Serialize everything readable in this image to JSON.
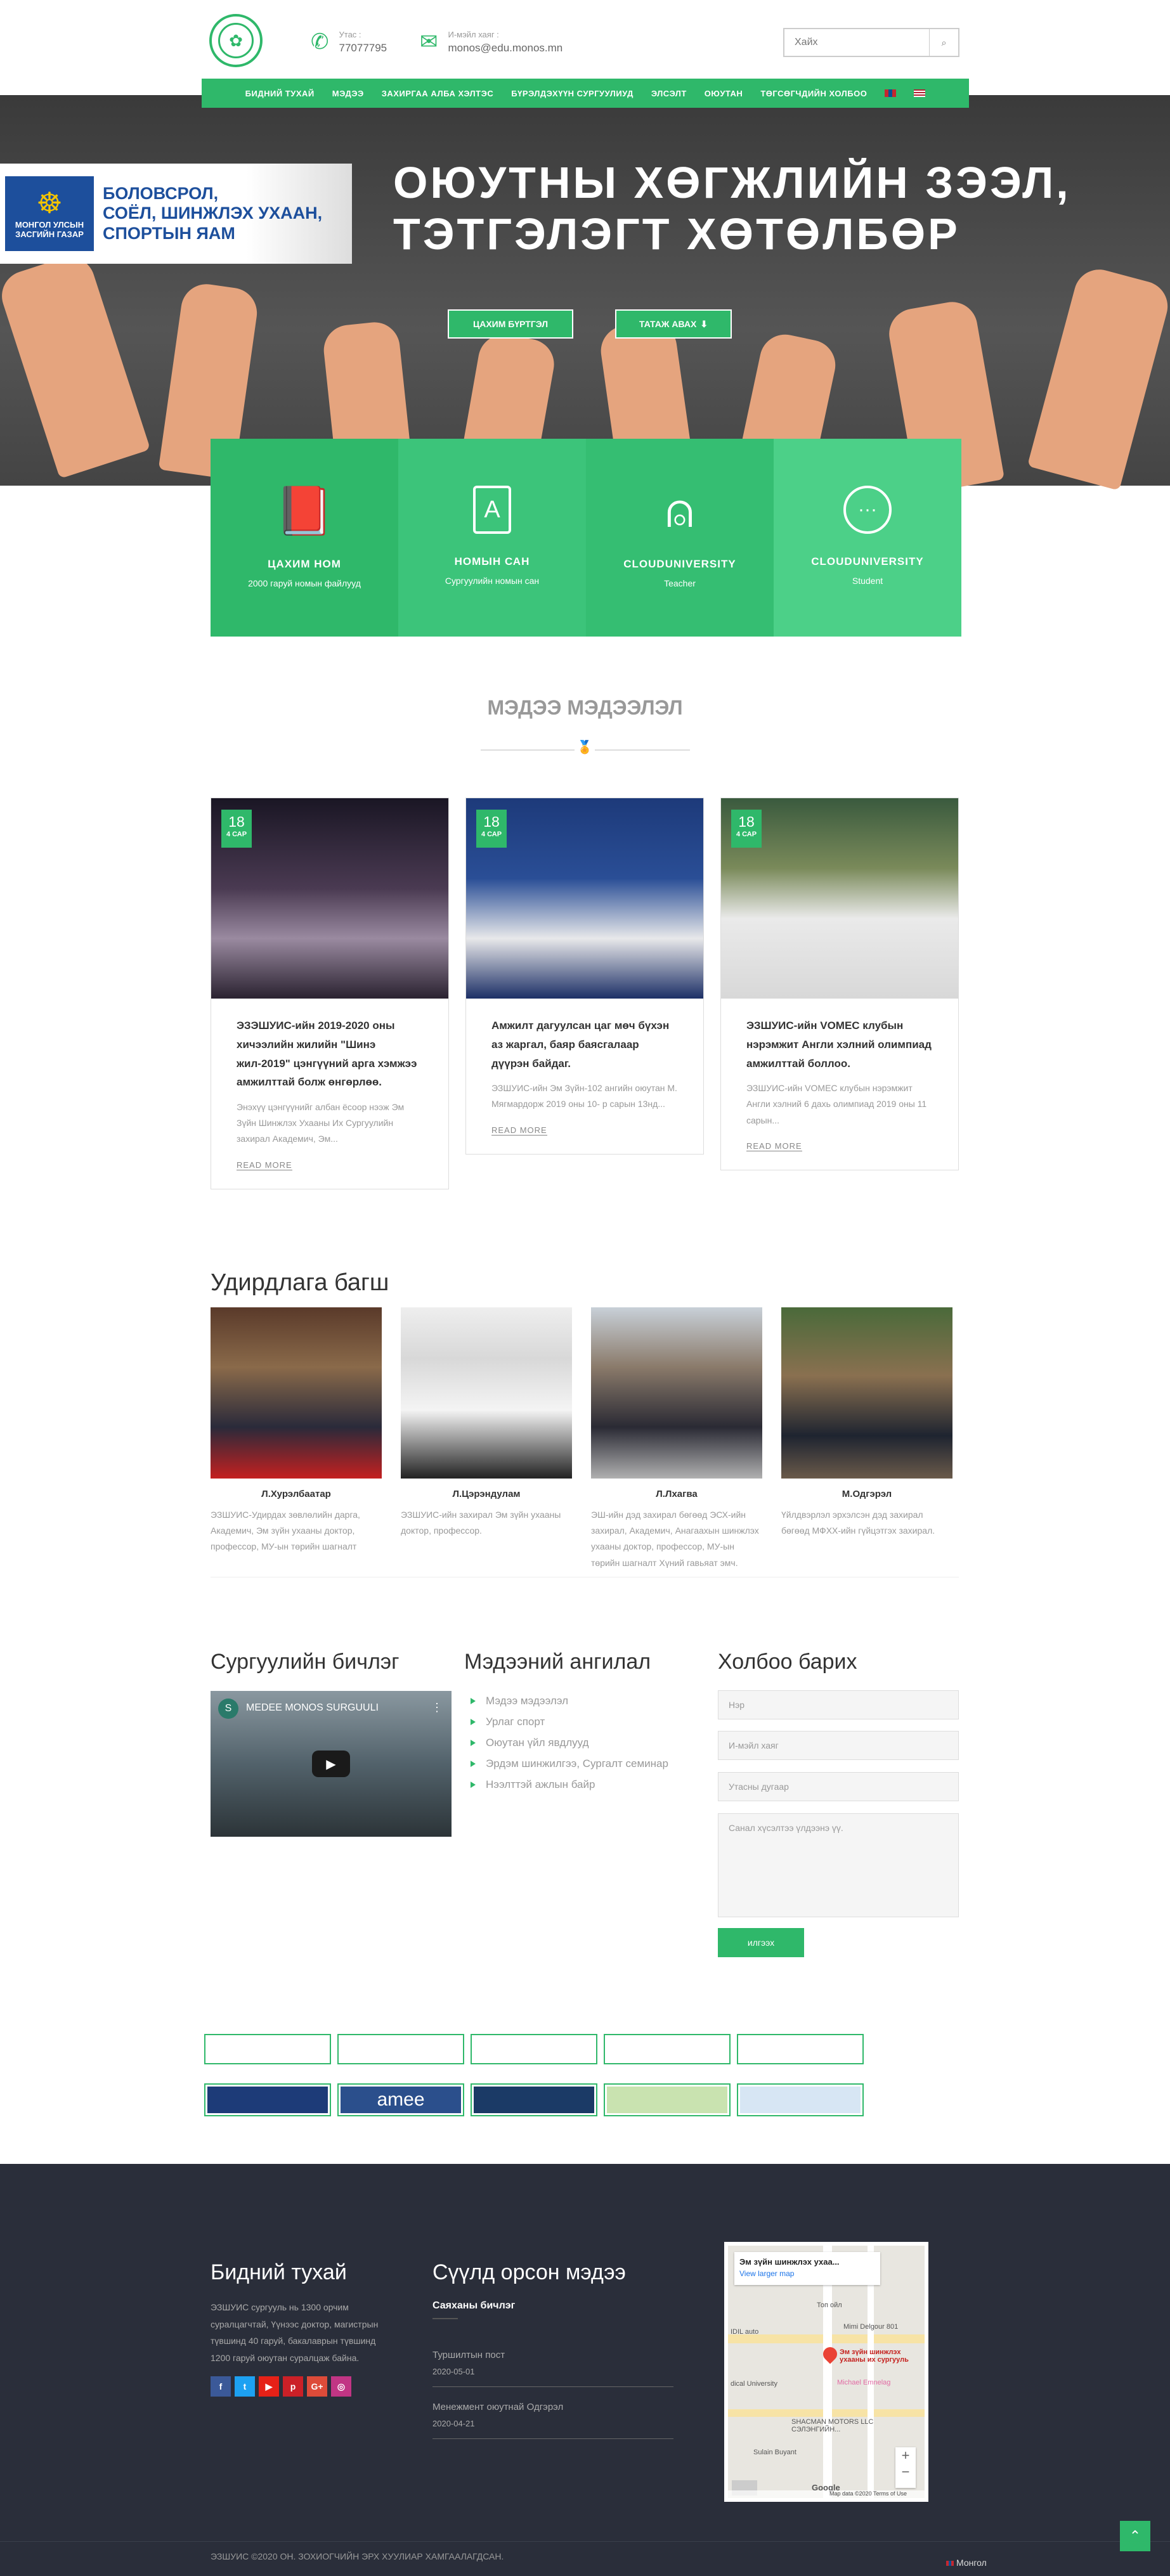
{
  "header": {
    "phone_label": "Утас :",
    "phone": "77077795",
    "email_label": "И-мэйл хаяг :",
    "email": "monos@edu.monos.mn",
    "search_placeholder": "Хайх",
    "nav": [
      "БИДНИЙ ТУХАЙ",
      "МЭДЭЭ",
      "ЗАХИРГАА АЛБА ХЭЛТЭС",
      "БҮРЭЛДЭХҮҮН СУРГУУЛИУД",
      "ЭЛСЭЛТ",
      "ОЮУТАН",
      "ТӨГСӨГЧДИЙН ХОЛБОО"
    ]
  },
  "hero": {
    "emblem_caption": "МОНГОЛ УЛСЫН ЗАСГИЙН ГАЗАР",
    "ministry": [
      "БОЛОВСРОЛ,",
      "СОЁЛ, ШИНЖЛЭХ УХААН,",
      "СПОРТЫН ЯАМ"
    ],
    "title_line1": "ОЮУТНЫ ХӨГЖЛИЙН ЗЭЭЛ,",
    "title_line2": "ТЭТГЭЛЭГТ ХӨТӨЛБӨР",
    "btn_register": "ЦАХИМ БҮРТГЭЛ",
    "btn_download": "ТАТАЖ АВАХ"
  },
  "features": [
    {
      "title": "ЦАХИМ НОМ",
      "sub": "2000 гаруй номын файлууд",
      "icon": "book-icon",
      "color": "#2fb86a"
    },
    {
      "title": "НОМЫН САН",
      "sub": "Сургуулийн номын сан",
      "icon": "library-icon",
      "color": "#3cc47a"
    },
    {
      "title": "CLOUDUNIVERSITY",
      "sub": "Teacher",
      "icon": "teacher-icon",
      "color": "#35be72"
    },
    {
      "title": "CLOUDUNIVERSITY",
      "sub": "Student",
      "icon": "chat-icon",
      "color": "#4cd088"
    }
  ],
  "news_section": {
    "title": "МЭДЭЭ МЭДЭЭЛЭЛ"
  },
  "news": [
    {
      "day": "18",
      "month": "4 САР",
      "title": "ЭЗЭШУИС-ийн 2019-2020 оны хичээлийн жилийн \"Шинэ жил-2019\" цэнгүүний арга хэмжээ амжилттай болж өнгөрлөө.",
      "excerpt": "Энэхүү цэнгүүнийг албан ёсоор нээж Эм Зүйн Шинжлэх Ухааны Их Сургуулийн захирал Академич, Эм...",
      "more": "READ MORE"
    },
    {
      "day": "18",
      "month": "4 САР",
      "title": "Амжилт дагуулсан цаг мөч бүхэн аз жаргал, баяр баясгалаар дүүрэн байдаг.",
      "excerpt": "ЭЗШУИС-ийн Эм Зүйн-102 ангийн оюутан М. Мягмардорж 2019 оны 10- р сарын 13нд...",
      "more": "READ MORE"
    },
    {
      "day": "18",
      "month": "4 САР",
      "title": "ЭЗШУИС-ийн VOMEC клубын нэрэмжит Англи хэлний олимпиад амжилттай боллоо.",
      "excerpt": "ЭЗШУИС-ийн VOMEC клубын нэрэмжит Англи хэлний 6 дахь олимпиад 2019 оны 11 сарын...",
      "more": "READ MORE"
    }
  ],
  "staff_section": {
    "title": "Удирдлага багш"
  },
  "staff": [
    {
      "name": "Л.Хурэлбаатар",
      "desc": "ЭЗШУИС-Удирдах зөвлөлийн дарга, Академич, Эм зүйн ухааны доктор, профессор, МУ-ын төрийн шагналт"
    },
    {
      "name": "Л.Цэрэндулам",
      "desc": "ЭЗШУИС-ийн захирал Эм зүйн ухааны доктор, профессор."
    },
    {
      "name": "Л.Лхагва",
      "desc": "ЭШ-ийн дэд захирал бөгөөд ЭСХ-ийн захирал, Академич, Анагаахын шинжлэх ухааны доктор, профессор, МУ-ын төрийн шагналт Хүний гавьяат эмч."
    },
    {
      "name": "М.Одгэрэл",
      "desc": "Үйлдвэрлэл эрхэлсэн дэд захирал бөгөөд МФХХ-ийн гүйцэтгэх захирал."
    }
  ],
  "video": {
    "title": "Сургуулийн бичлэг",
    "caption": "MEDEE MONOS SURGUULI"
  },
  "categories": {
    "title": "Мэдээний ангилал",
    "items": [
      "Мэдээ мэдээлэл",
      "Урлаг спорт",
      "Оюутан үйл явдлууд",
      "Эрдэм шинжилгээ, Сургалт семинар",
      "Нээлттэй ажлын байр"
    ]
  },
  "contact_form": {
    "title": "Холбоо барих",
    "name": "Нэр",
    "email": "И-мэйл хаяг",
    "phone": "Утасны дугаар",
    "message": "Санал хүсэлтээ үлдээнэ үү.",
    "send": "илгээх"
  },
  "partners": [
    {
      "label": "",
      "bg": "#1d3b78",
      "color": "#fff"
    },
    {
      "label": "amee",
      "bg": "#2b4f8c",
      "color": "#fff"
    },
    {
      "label": "",
      "bg": "#1b3a66",
      "color": "#fff"
    },
    {
      "label": "",
      "bg": "#c9e3b0",
      "color": "#333"
    },
    {
      "label": "",
      "bg": "#d7e6f4",
      "color": "#1d4f9c"
    }
  ],
  "footer": {
    "about_title": "Бидний тухай",
    "about_text": "ЭЗШУИС сургууль нь 1300 орчим суралцагчтай, Үүнээс доктор, магистрын түвшинд 40 гаруй, бакалаврын түвшинд 1200 гаруй оюутан суралцаж байна.",
    "recent_title": "Сүүлд орсон мэдээ",
    "recent_sub": "Саяханы бичлэг",
    "posts": [
      {
        "title": "Туршилтын пост",
        "date": "2020-05-01"
      },
      {
        "title": "Менежмент оюутнай Одгэрэл",
        "date": "2020-04-21"
      }
    ],
    "social": [
      "f",
      "t",
      "▶",
      "p",
      "G+",
      "◎"
    ],
    "copyright": "ЭЗШУИС ©2020 ОН. ЗОХИОГЧИЙН ЭРХ ХУУЛИАР ХАМГААЛАГДСАН.",
    "lang": "Монгол"
  },
  "map": {
    "place": "Эм зүйн шинжлэх ухаа...",
    "larger": "View larger map",
    "labels": [
      "Топ ойл",
      "Mimi Delgour 801",
      "IDIL auto",
      "Эм зүйн шинжлэх ухааны их сургууль",
      "Michael Emnelag",
      "dical University",
      "SHACMAN MOTORS LLC СЭЛЭНГИЙН...",
      "Sulain Buyant",
      "Map data ©2020",
      "Terms of Use",
      "Google"
    ]
  }
}
